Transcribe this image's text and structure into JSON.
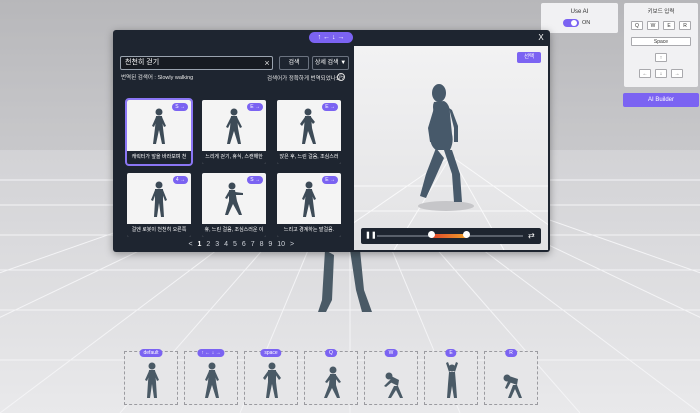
{
  "modal": {
    "tab_label": "↑ ← ↓ →",
    "close": "X",
    "search_value": "천천히 걷기",
    "search_clear": "×",
    "search_button": "검색",
    "advanced_search": "상세 검색 ▼",
    "translated_label": "번역된 검색어 : Slowly walking",
    "hint": "검색어가 정확하게 번역되었나요?",
    "hint_icon": "!",
    "cards": [
      {
        "badge": "S →",
        "caption": "캐릭터가 앞을 바라보며 천"
      },
      {
        "badge": "E →",
        "caption": "느리게 걷기, 휴식, 스캔해한"
      },
      {
        "badge": "E →",
        "caption": "앉은 후, 느린 걸음, 조심스러"
      },
      {
        "badge": "4 →",
        "caption": "걸엔 로봇이 천천히 오른쪽"
      },
      {
        "badge": "S →",
        "caption": "휴, 느린 걸음, 조심스러운 이"
      },
      {
        "badge": "E →",
        "caption": "느리고 경계하는 발걸음."
      }
    ],
    "pager": {
      "prev": "<",
      "pages": [
        "1",
        "2",
        "3",
        "4",
        "5",
        "6",
        "7",
        "8",
        "9",
        "10"
      ],
      "current": "1",
      "next": ">"
    },
    "preview": {
      "select_button": "선택"
    }
  },
  "use_ai": {
    "label": "Use AI",
    "toggle_state": "ON"
  },
  "keyboard": {
    "title": "키보드 입력",
    "row1": [
      "Q",
      "W",
      "E",
      "R"
    ],
    "space": "Space",
    "arrows": {
      "up": "↑",
      "left": "←",
      "down": "↓",
      "right": "→"
    }
  },
  "ai_builder": "AI Builder",
  "shelf": [
    "default",
    "↑ ← ↓ →",
    "space",
    "Q",
    "W",
    "E",
    "R"
  ],
  "colors": {
    "accent": "#7b63f2",
    "modal_bg": "#1e2530",
    "timeline_red": "#e0452b",
    "timeline_orange": "#f0a02b"
  }
}
